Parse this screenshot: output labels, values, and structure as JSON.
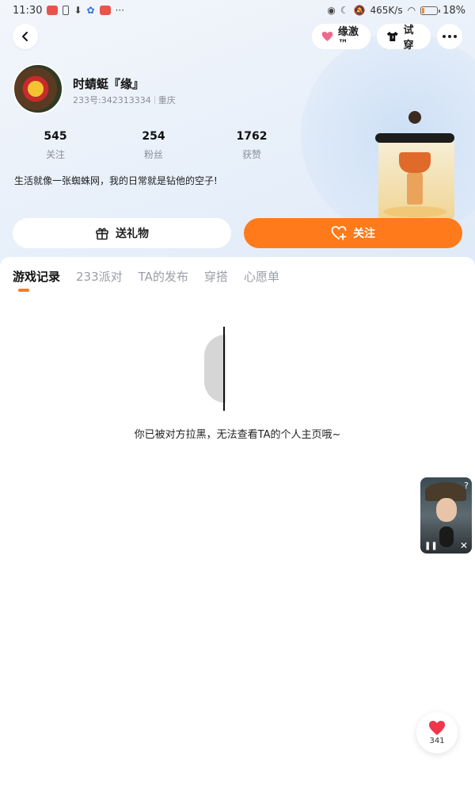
{
  "status_bar": {
    "time": "11:30",
    "net_speed": "465K/s",
    "battery": "18%",
    "battery_level": 0.18
  },
  "nav": {
    "yuanji_label": "缘激™",
    "try_on_label": "试穿",
    "icons": [
      "back-icon",
      "heart-icon",
      "tshirt-icon",
      "more-icon"
    ]
  },
  "profile": {
    "name": "时蜻蜓『缘』",
    "id_text": "233号:342313334",
    "location": "重庆",
    "bio": "生活就像一张蜘蛛网，我的日常就是钻他的空子!",
    "stats": [
      {
        "value": "545",
        "label": "关注"
      },
      {
        "value": "254",
        "label": "粉丝"
      },
      {
        "value": "1762",
        "label": "获赞"
      }
    ]
  },
  "actions": {
    "gift_label": "送礼物",
    "follow_label": "关注"
  },
  "tabs": [
    {
      "label": "游戏记录",
      "active": true
    },
    {
      "label": "233派对",
      "active": false
    },
    {
      "label": "TA的发布",
      "active": false
    },
    {
      "label": "穿搭",
      "active": false
    },
    {
      "label": "心愿单",
      "active": false
    }
  ],
  "empty_state": {
    "message": "你已被对方拉黑，无法查看TA的个人主页哦~"
  },
  "like": {
    "count": "341"
  },
  "colors": {
    "accent": "#ff7a1a",
    "like_heart": "#f0364a",
    "yuanji_heart": "#f06a8a"
  }
}
